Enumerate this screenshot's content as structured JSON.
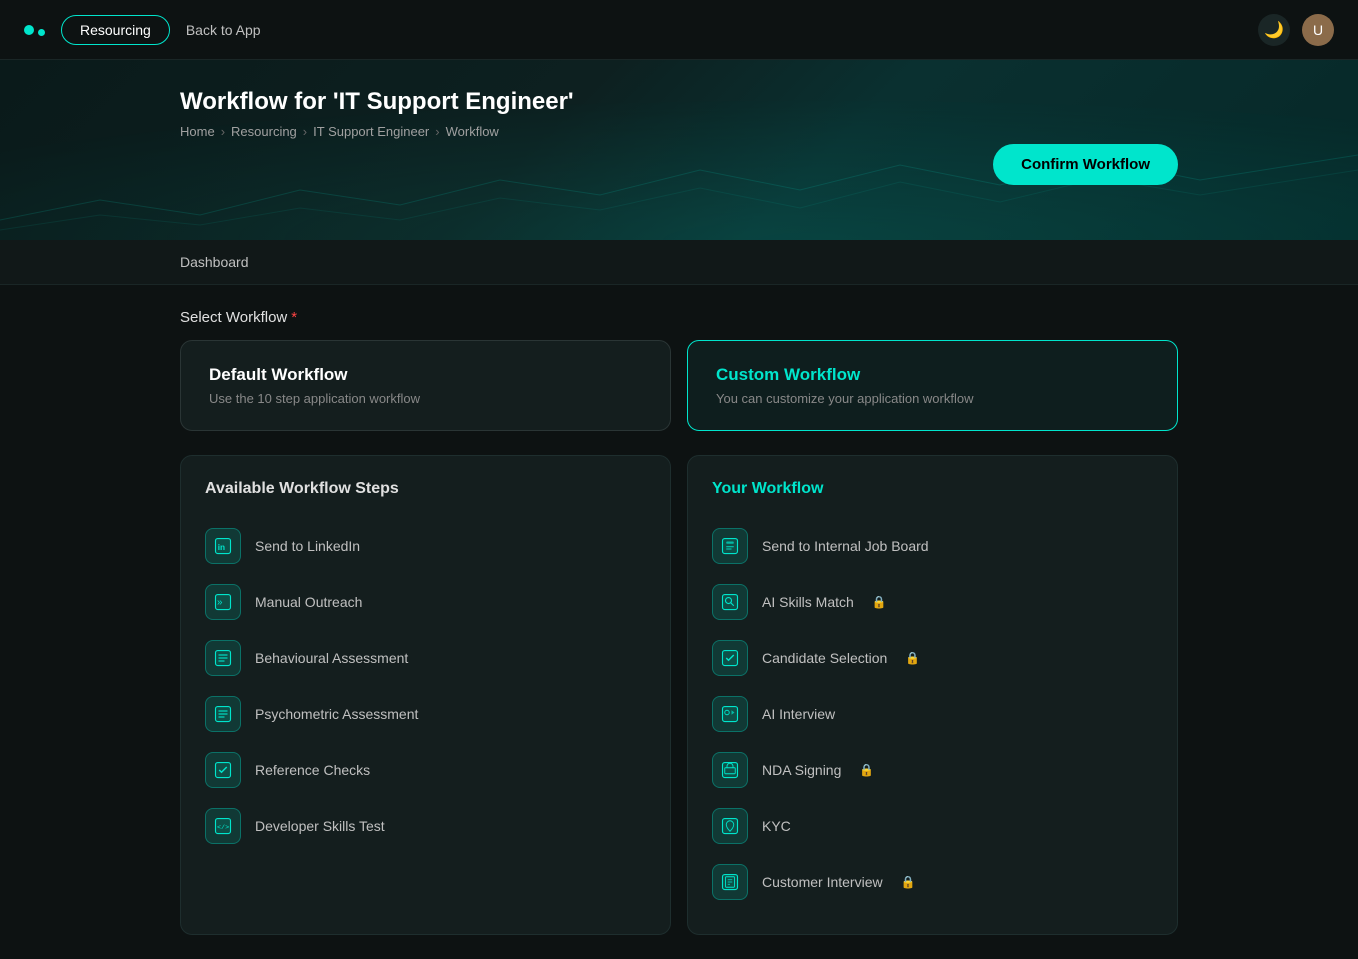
{
  "navbar": {
    "logo_label": "Logo",
    "resourcing_label": "Resourcing",
    "back_link": "Back to App",
    "theme_icon": "🌙",
    "avatar_label": "U"
  },
  "hero": {
    "title": "Workflow for 'IT Support Engineer'",
    "breadcrumb": [
      "Home",
      "Resourcing",
      "IT Support Engineer",
      "Workflow"
    ],
    "confirm_btn": "Confirm Workflow"
  },
  "dashboard_label": "Dashboard",
  "select_workflow": {
    "label": "Select Workflow",
    "cards": [
      {
        "id": "default",
        "title": "Default Workflow",
        "desc": "Use the 10 step application workflow",
        "selected": false
      },
      {
        "id": "custom",
        "title": "Custom Workflow",
        "desc": "You can customize your application workflow",
        "selected": true
      }
    ]
  },
  "available_steps": {
    "title": "Available Workflow Steps",
    "items": [
      {
        "id": "linkedin",
        "icon": "in",
        "label": "Send to LinkedIn"
      },
      {
        "id": "manual",
        "icon": "»",
        "label": "Manual Outreach"
      },
      {
        "id": "behavioural",
        "icon": "☰",
        "label": "Behavioural Assessment"
      },
      {
        "id": "psychometric",
        "icon": "☰",
        "label": "Psychometric Assessment"
      },
      {
        "id": "reference",
        "icon": "✔",
        "label": "Reference Checks"
      },
      {
        "id": "devskills",
        "icon": "</>",
        "label": "Developer Skills Test"
      }
    ]
  },
  "your_workflow": {
    "title": "Your Workflow",
    "items": [
      {
        "id": "internal-job-board",
        "icon": "📋",
        "label": "Send to Internal Job Board",
        "locked": false
      },
      {
        "id": "ai-skills",
        "icon": "🔍",
        "label": "AI Skills Match",
        "locked": true
      },
      {
        "id": "candidate-selection",
        "icon": "✔",
        "label": "Candidate Selection",
        "locked": true
      },
      {
        "id": "ai-interview",
        "icon": "🎙",
        "label": "AI Interview",
        "locked": false
      },
      {
        "id": "nda",
        "icon": "🖨",
        "label": "NDA Signing",
        "locked": true
      },
      {
        "id": "kyc",
        "icon": "🔐",
        "label": "KYC",
        "locked": false
      },
      {
        "id": "customer-interview",
        "icon": "📄",
        "label": "Customer Interview",
        "locked": true
      }
    ]
  }
}
